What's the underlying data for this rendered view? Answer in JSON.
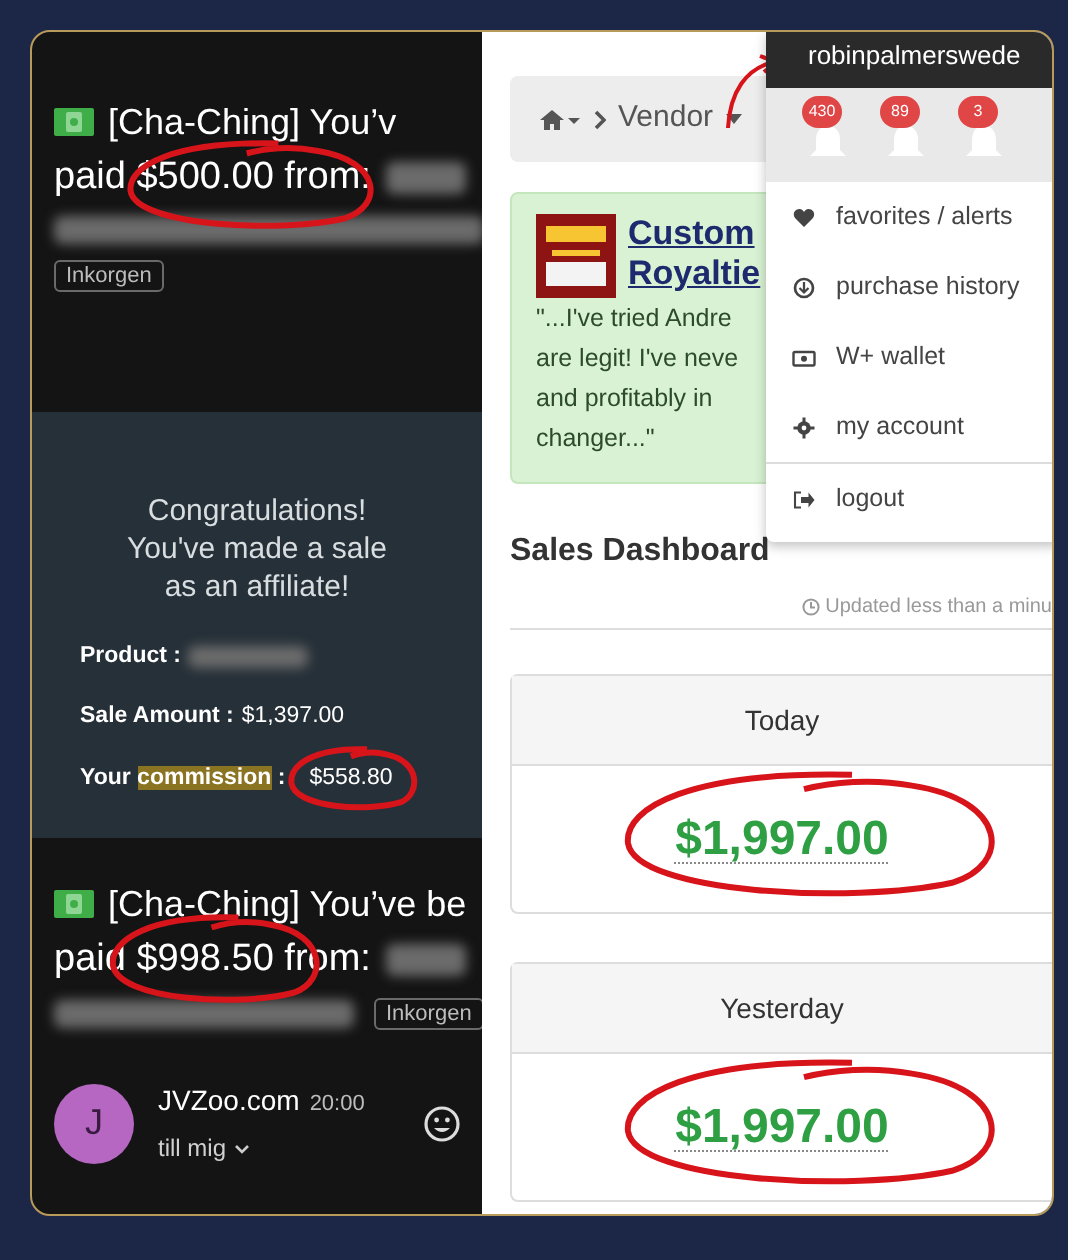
{
  "emails": [
    {
      "subject": [
        "[Cha-Ching] You’v",
        "paid $500.00 from:"
      ],
      "label": "Inkorgen"
    },
    {
      "subject": [
        "[Cha-Ching] You’ve be",
        "paid $998.50 from:"
      ],
      "label": "Inkorgen",
      "sender": {
        "initial": "J",
        "name": "JVZoo.com",
        "time": "20:00",
        "recipient": "till mig"
      }
    }
  ],
  "affiliate_notice": {
    "heading": "Congratulations! You've made a sale as an affiliate!",
    "fields": [
      {
        "label": "Product :"
      },
      {
        "label": "Sale Amount :",
        "value": "$1,397.00"
      },
      {
        "label": "Your",
        "highlight": "commission",
        "suffix": ":",
        "value": "$558.80"
      }
    ]
  },
  "vendor_site": {
    "username": "robinpalmerswede",
    "breadcrumb": "Vendor",
    "badges": [
      "430",
      "89",
      "3"
    ],
    "deal": {
      "title": [
        "Custom",
        "Royaltie"
      ],
      "quote": [
        "\"...I've tried Andre",
        "are legit! I've neve",
        "and profitably in",
        "changer...\""
      ]
    },
    "menu": [
      {
        "kind": "heart",
        "label": "favorites / alerts"
      },
      {
        "kind": "download",
        "label": "purchase history"
      },
      {
        "kind": "wallet",
        "label": "W+ wallet"
      },
      {
        "kind": "gear",
        "label": "my account"
      },
      {
        "kind": "logout",
        "label": "logout"
      }
    ],
    "dashboard": {
      "title": "Sales Dashboard",
      "updated": "Updated less than a minu",
      "cards": [
        {
          "title": "Today",
          "amount": "$1,997.00"
        },
        {
          "title": "Yesterday",
          "amount": "$1,997.00"
        }
      ]
    }
  }
}
